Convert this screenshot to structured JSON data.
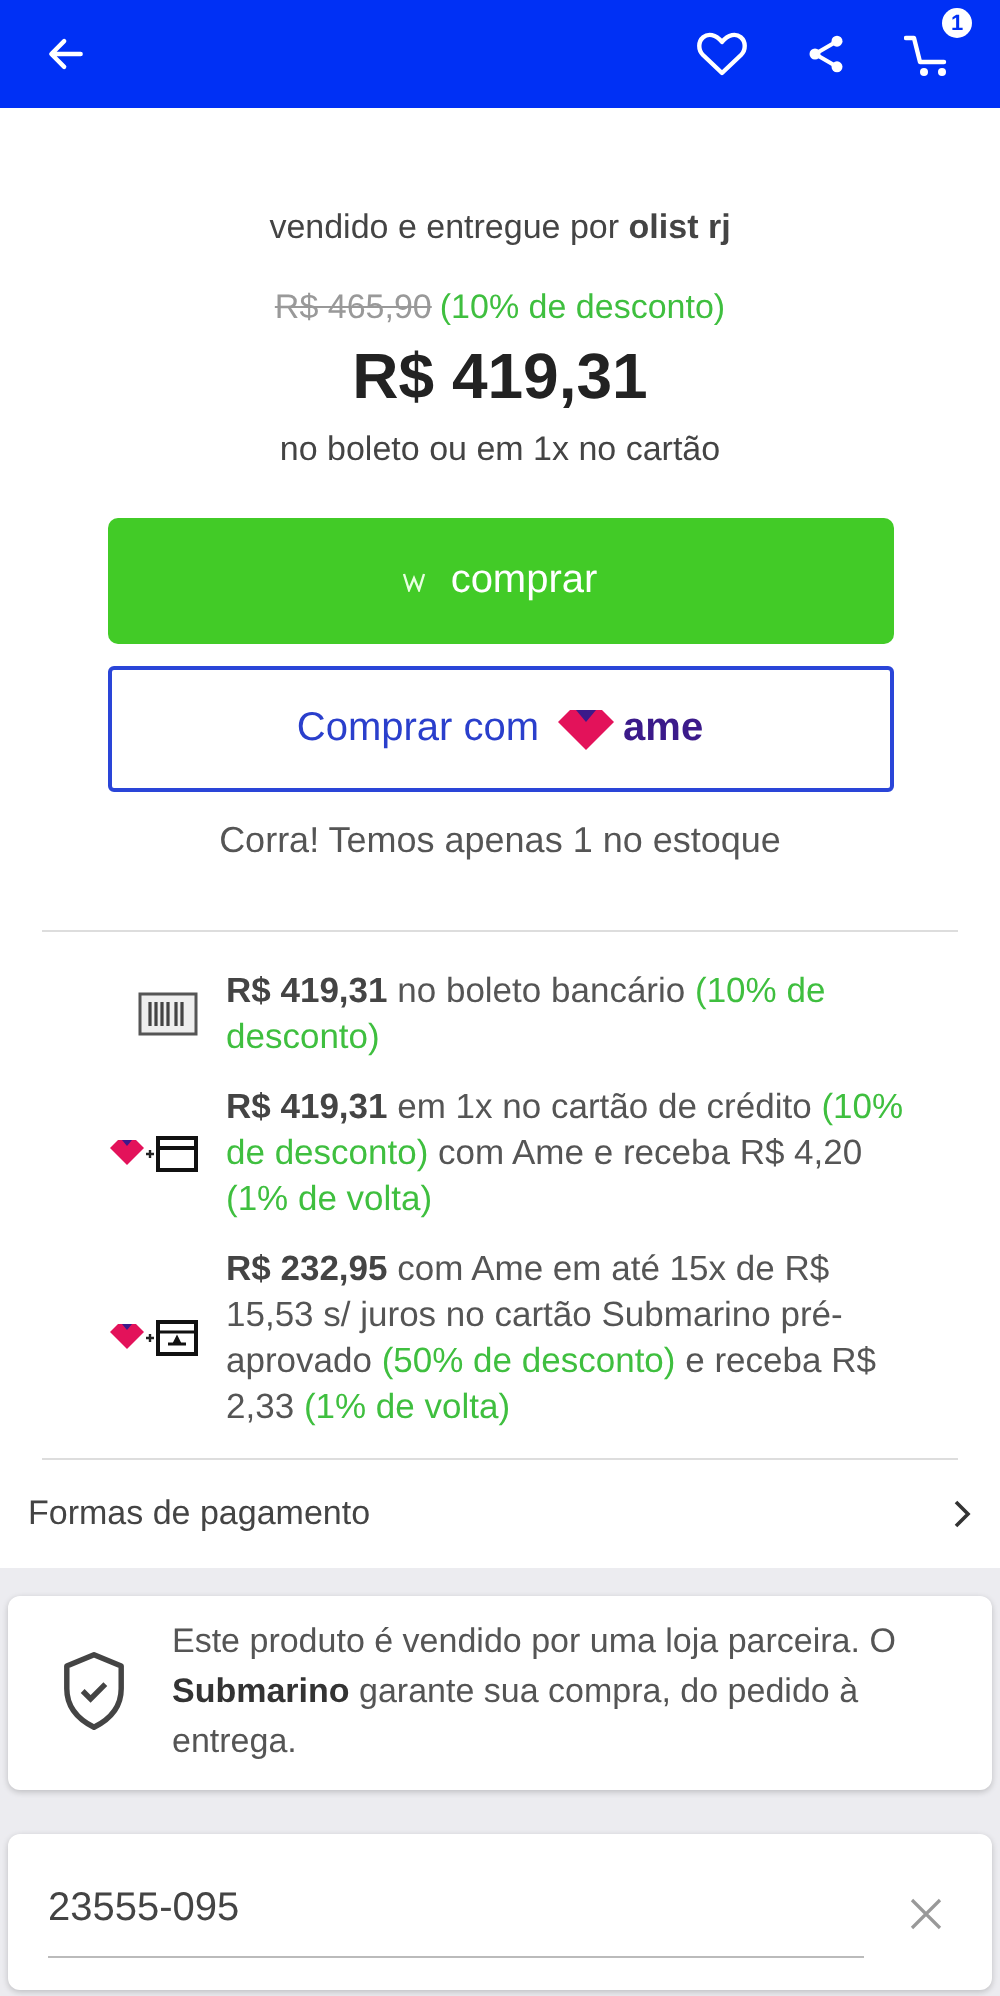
{
  "header": {
    "cart_count": "1"
  },
  "seller": {
    "prefix": "vendido e entregue por",
    "name": "olist rj"
  },
  "price": {
    "old": "R$ 465,90",
    "discount": "(10% de desconto)",
    "current": "R$ 419,31",
    "terms": "no boleto ou em 1x no cartão"
  },
  "buy_button": {
    "label": "comprar"
  },
  "ame_button": {
    "label": "Comprar com",
    "logo": "ame"
  },
  "stock_note": "Corra! Temos apenas 1 no estoque",
  "payment_options": [
    {
      "kind": "boleto",
      "segments": [
        {
          "text": "R$ 419,31",
          "bold": true,
          "highlight": false
        },
        {
          "text": " no boleto bancário ",
          "bold": false,
          "highlight": false
        },
        {
          "text": "(10% de desconto)",
          "bold": false,
          "highlight": true
        }
      ]
    },
    {
      "kind": "ame_card",
      "segments": [
        {
          "text": "R$ 419,31",
          "bold": true,
          "highlight": false
        },
        {
          "text": " em 1x no cartão de crédito ",
          "bold": false,
          "highlight": false
        },
        {
          "text": "(10% de desconto)",
          "bold": false,
          "highlight": true
        },
        {
          "text": " com Ame e receba R$ 4,20 ",
          "bold": false,
          "highlight": false
        },
        {
          "text": "(1% de volta)",
          "bold": false,
          "highlight": true
        }
      ]
    },
    {
      "kind": "ame_store_card",
      "segments": [
        {
          "text": "R$ 232,95",
          "bold": true,
          "highlight": false
        },
        {
          "text": " com Ame em até 15x de R$ 15,53 s/ juros no cartão Submarino pré-aprovado  ",
          "bold": false,
          "highlight": false
        },
        {
          "text": "(50% de desconto)",
          "bold": false,
          "highlight": true
        },
        {
          "text": " e receba R$ 2,33 ",
          "bold": false,
          "highlight": false
        },
        {
          "text": "(1% de volta)",
          "bold": false,
          "highlight": true
        }
      ]
    }
  ],
  "payment_methods_link": "Formas de pagamento",
  "guarantee": {
    "text": "Este produto é vendido por uma loja parceira. O **Submarino** garante sua compra, do pedido à entrega."
  },
  "zip_field": {
    "value": "23555-095"
  }
}
